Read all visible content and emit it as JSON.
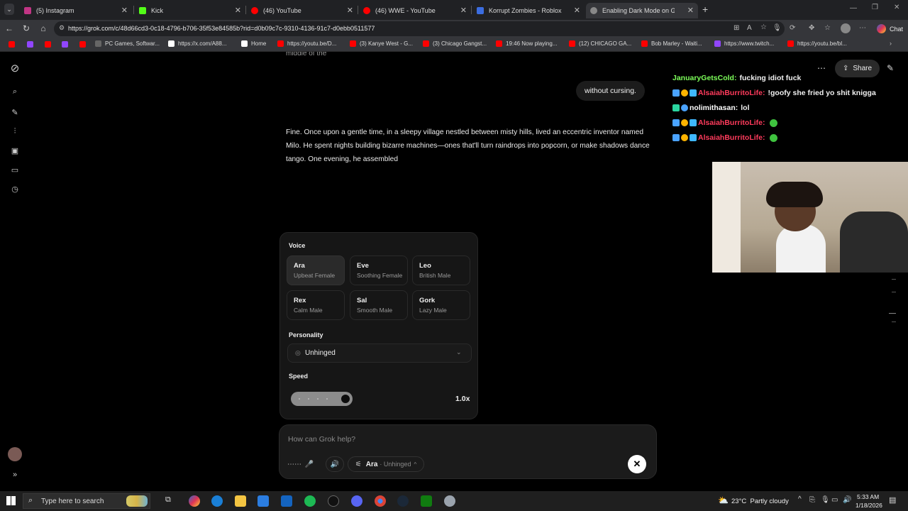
{
  "browser": {
    "tabs": [
      {
        "title": "(5) Instagram",
        "color": "#c13584"
      },
      {
        "title": "Kick",
        "color": "#53fc18"
      },
      {
        "title": "(46) YouTube",
        "color": "#ff0000"
      },
      {
        "title": "(46) WWE - YouTube",
        "color": "#ff0000"
      },
      {
        "title": "Korrupt Zombies - Roblox",
        "color": "#3b6de0"
      },
      {
        "title": "Enabling Dark Mode on Grok",
        "color": "#888888"
      }
    ],
    "url": "https://grok.com/c/48d66cd3-0c18-4796-b706-35f53e84585b?rid=d0b09c7c-9310-4136-91c7-d0ebb0511577",
    "chat_label": "Chat",
    "bookmarks": [
      {
        "label": "PC Games, Softwar...",
        "color": "#666666"
      },
      {
        "label": "https://x.com/A88...",
        "color": "#ffffff"
      },
      {
        "label": "Home",
        "color": "#ffffff"
      },
      {
        "label": "https://youtu.be/D...",
        "color": "#ff0000"
      },
      {
        "label": "(3) Kanye West - G...",
        "color": "#ff0000"
      },
      {
        "label": "(3) Chicago Gangst...",
        "color": "#ff0000"
      },
      {
        "label": "19:46 Now playing...",
        "color": "#ff0000"
      },
      {
        "label": "(12) CHICAGO GA...",
        "color": "#ff0000"
      },
      {
        "label": "Bob Marley - Waiti...",
        "color": "#ff0000"
      },
      {
        "label": "https://www.twitch...",
        "color": "#9146ff"
      },
      {
        "label": "https://youtu.be/bl...",
        "color": "#ff0000"
      }
    ]
  },
  "conversation": {
    "cut_text": "middle of the",
    "user_message": "without cursing.",
    "assistant_reply": "Fine. Once upon a gentle time, in a sleepy village nestled between misty hills, lived an eccentric inventor named Milo. He spent nights building bizarre machines—ones that'll turn raindrops into popcorn, or make shadows dance tango. One evening, he assembled"
  },
  "voice_panel": {
    "voice_label": "Voice",
    "voices": [
      {
        "name": "Ara",
        "desc": "Upbeat Female"
      },
      {
        "name": "Eve",
        "desc": "Soothing Female"
      },
      {
        "name": "Leo",
        "desc": "British Male"
      },
      {
        "name": "Rex",
        "desc": "Calm Male"
      },
      {
        "name": "Sal",
        "desc": "Smooth Male"
      },
      {
        "name": "Gork",
        "desc": "Lazy Male"
      }
    ],
    "selected_voice_index": 0,
    "personality_label": "Personality",
    "personality_value": "Unhinged",
    "speed_label": "Speed",
    "speed_value": "1.0x"
  },
  "composer": {
    "placeholder": "How can Grok help?",
    "voice_name": "Ara",
    "voice_mode": "· Unhinged"
  },
  "header": {
    "share_label": "Share"
  },
  "chat_overlay": [
    {
      "user": "JanuaryGetsCold:",
      "message": "fucking idiot fuck",
      "user_color": "#7dff5a"
    },
    {
      "user": "AlsaiahBurritoLife:",
      "message": "!goofy she fried yo shit knigga",
      "user_color": "#ff3b5c"
    },
    {
      "user": "nolimithasan:",
      "message": "lol",
      "user_color": "#ffffff"
    },
    {
      "user": "AlsaiahBurritoLife:",
      "message": "",
      "user_color": "#ff3b5c"
    },
    {
      "user": "AlsaiahBurritoLife:",
      "message": "",
      "user_color": "#ff3b5c"
    }
  ],
  "taskbar": {
    "search_placeholder": "Type here to search",
    "weather": "23°C  Partly cloudy",
    "time": "5:33 AM",
    "date": "1/18/2026"
  }
}
